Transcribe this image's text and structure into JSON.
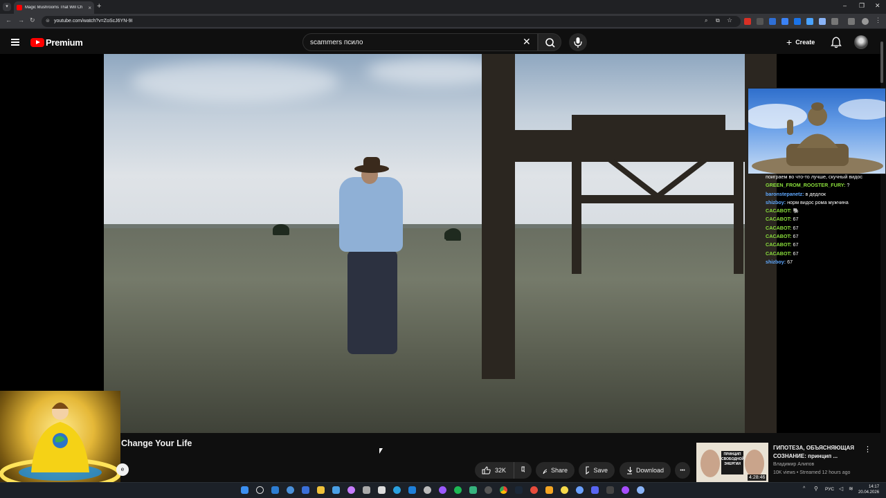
{
  "browser": {
    "tab_title": "Magic Mushrooms That Will Ch",
    "tab_close": "×",
    "new_tab": "+",
    "url": "youtube.com/watch?v=ZoScJ6YN-9I",
    "window_min": "–",
    "window_max": "❐",
    "window_close": "✕"
  },
  "header": {
    "logo_text": "Premium",
    "search_value": "scammers псило",
    "create_label": "Create"
  },
  "video": {
    "title": "Change Your Life",
    "channel_initial": "e",
    "like_count": "32K",
    "share_label": "Share",
    "save_label": "Save",
    "download_label": "Download",
    "more_label": "•••"
  },
  "chat": {
    "lines": [
      {
        "user": "",
        "msg": "поиграем во что-то лучше, скучный видос",
        "color": "#ffffff"
      },
      {
        "user": "GREEN_FROM_ROOSTER_FURY:",
        "msg": "?",
        "color": "#8be03c"
      },
      {
        "user": "baronstepanetz:",
        "msg": "в дедлок",
        "color": "#5fa8ff"
      },
      {
        "user": "shizboy:",
        "msg": "норм видос рома мужчина",
        "color": "#5fa8ff"
      },
      {
        "user": "CACABOT:",
        "msg": "🐘",
        "color": "#8be03c"
      },
      {
        "user": "CACABOT:",
        "msg": "67",
        "color": "#8be03c"
      },
      {
        "user": "CACABOT:",
        "msg": "67",
        "color": "#8be03c"
      },
      {
        "user": "CACABOT:",
        "msg": "67",
        "color": "#8be03c"
      },
      {
        "user": "CACABOT:",
        "msg": "67",
        "color": "#8be03c"
      },
      {
        "user": "CACABOT:",
        "msg": "67",
        "color": "#8be03c"
      },
      {
        "user": "shizboy:",
        "msg": "67",
        "color": "#5fa8ff"
      }
    ]
  },
  "recommended": {
    "title": "ГИПОТЕЗА, ОБЪЯСНЯЮЩАЯ СОЗНАНИЕ: принцип ...",
    "channel": "Владимир Алипов",
    "meta": "10K views • Streamed 12 hours ago",
    "duration": "4:28:46",
    "thumb_text": "ПРИНЦИП СВОБОДНОЙ ЭНЕРГИИ",
    "more": "⋮"
  },
  "taskbar": {
    "lang": "РУС",
    "time": "14:17",
    "date": "20.04.2026"
  },
  "colors": {
    "youtube_red": "#ff0000",
    "chat_green": "#8be03c",
    "chat_blue": "#5fa8ff"
  }
}
